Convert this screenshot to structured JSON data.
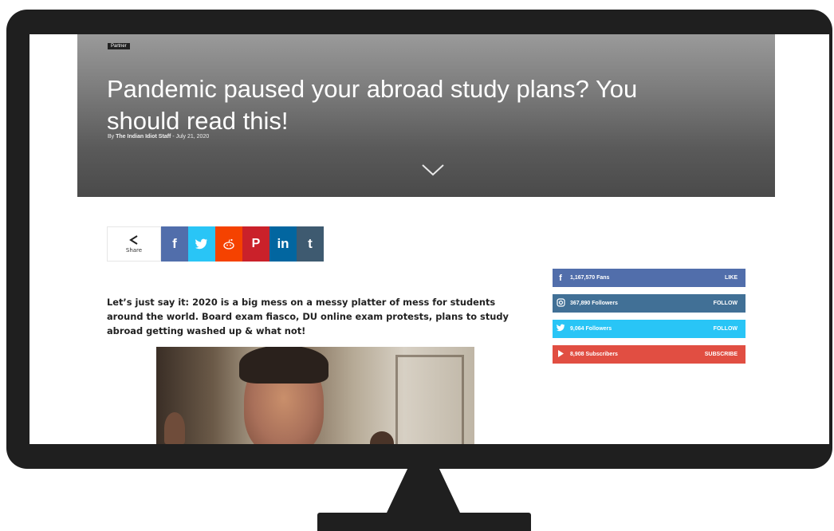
{
  "article": {
    "category": "Partner",
    "title": "Pandemic paused your abroad study plans? You should read this!",
    "byline_prefix": "By",
    "author": "The Indian Idiot Staff",
    "date_sep": "-",
    "date": "July 21, 2020",
    "intro": "Let’s just say it: 2020 is a big mess on a messy platter of mess for students around the world. Board exam fiasco, DU online exam protests, plans to study abroad getting washed up & what not!"
  },
  "share": {
    "label": "Share",
    "buttons": [
      {
        "glyph": "f",
        "icon": "facebook-icon"
      },
      {
        "glyph": "🐦",
        "icon": "twitter-icon"
      },
      {
        "glyph": "◉",
        "icon": "reddit-icon"
      },
      {
        "glyph": "P",
        "icon": "pinterest-icon"
      },
      {
        "glyph": "in",
        "icon": "linkedin-icon"
      },
      {
        "glyph": "t",
        "icon": "tumblr-icon"
      }
    ]
  },
  "social": {
    "facebook": {
      "count": "1,167,570",
      "unit": "Fans",
      "action": "LIKE"
    },
    "instagram": {
      "count": "367,890",
      "unit": "Followers",
      "action": "FOLLOW"
    },
    "twitter": {
      "count": "9,064",
      "unit": "Followers",
      "action": "FOLLOW"
    },
    "youtube": {
      "count": "8,908",
      "unit": "Subscribers",
      "action": "SUBSCRIBE"
    }
  },
  "colors": {
    "facebook": "#516eab",
    "twitter": "#29c5f6",
    "reddit": "#f54200",
    "pinterest": "#ca212a",
    "linkedin": "#0266a0",
    "tumblr": "#3e5a70",
    "instagram": "#417096",
    "youtube": "#e14e42"
  }
}
